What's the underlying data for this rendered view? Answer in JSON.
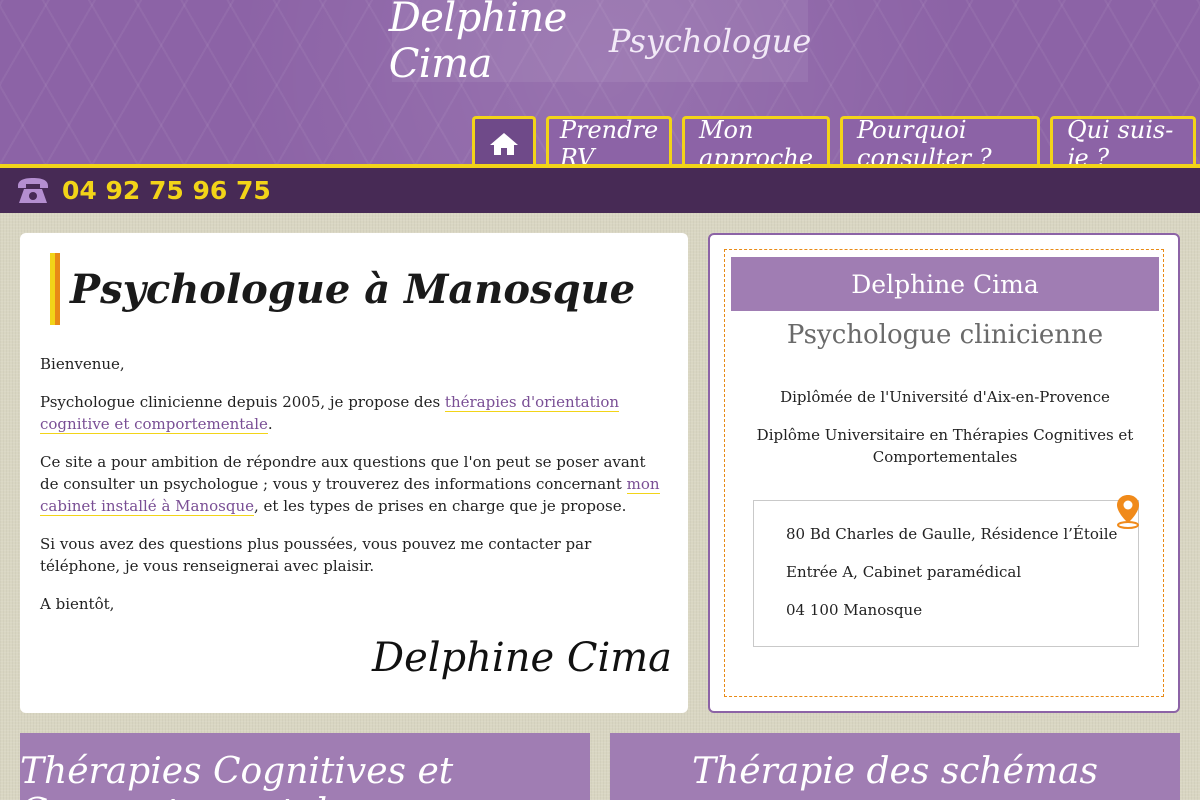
{
  "header": {
    "brand_name": "Delphine Cima",
    "brand_role": "Psychologue",
    "nav": [
      {
        "icon": "home-icon"
      },
      {
        "label": "Prendre RV"
      },
      {
        "label": "Mon approche"
      },
      {
        "label": "Pourquoi consulter ?"
      },
      {
        "label": "Qui suis-je ?"
      }
    ]
  },
  "phone": {
    "icon": "phone-icon",
    "number": "04 92 75 96 75"
  },
  "main": {
    "title": "Psychologue à Manosque",
    "greeting": "Bienvenue,",
    "p1_before": "Psychologue clinicienne depuis 2005, je propose des ",
    "p1_link": "thérapies d'orientation cognitive et comportementale",
    "p1_after": ".",
    "p2_before": "Ce site a pour ambition de répondre aux questions que l'on peut se poser avant de consulter un psychologue ; vous y trouverez des informations concernant ",
    "p2_link": "mon cabinet installé à Manosque",
    "p2_after": ", et les types de prises en charge que je propose.",
    "p3": "Si vous avez des questions plus poussées, vous pouvez me contacter par téléphone, je vous renseignerai avec plaisir.",
    "closing": "A bientôt,",
    "signature": "Delphine Cima"
  },
  "side": {
    "name": "Delphine Cima",
    "role": "Psychologue clinicienne",
    "diploma1": "Diplômée de l'Université d'Aix-en-Provence",
    "diploma2": "Diplôme Universitaire en Thérapies Cognitives et Comportementales",
    "address_line1": "80 Bd Charles de Gaulle, Résidence l’Étoile",
    "address_line2": "Entrée A, Cabinet paramédical",
    "address_line3": "04 100 Manosque",
    "pin_icon": "location-pin-icon"
  },
  "bottom": {
    "card1_title": "Thérapies Cognitives et Comportementales",
    "card2_title": "Thérapie des schémas"
  },
  "colors": {
    "purple": "#8c63a6",
    "dark_purple": "#472a55",
    "yellow": "#f2d418",
    "orange": "#e88a16",
    "light_purple": "#a07db3"
  }
}
